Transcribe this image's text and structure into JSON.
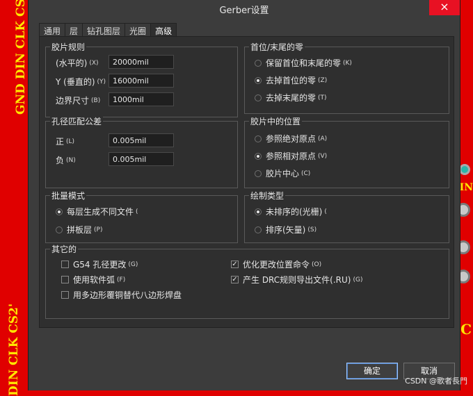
{
  "background": {
    "pcb_left_top": "GND DIN CLK CS1'",
    "pcb_left_bottom": "DIN CLK CS2'",
    "pcb_right_mid": "IN",
    "pcb_right_bottom": "C",
    "watermark": "CSDN @歌者長門"
  },
  "colors": {
    "pcb_bg": "#e00000",
    "silkscreen": "#ffe600",
    "dialog_bg": "#3c3c3c",
    "close_red": "#e81123"
  },
  "window": {
    "title": "Gerber设置",
    "close_icon": "×"
  },
  "tabs": [
    {
      "label": "通用"
    },
    {
      "label": "层"
    },
    {
      "label": "钻孔图层"
    },
    {
      "label": "光圈"
    },
    {
      "label": "高级"
    }
  ],
  "film_rules": {
    "title": "胶片规则",
    "x_label": "(水平的)",
    "x_shortcut": "(X)",
    "x_value": "20000mil",
    "y_label": "Y (垂直的)",
    "y_shortcut": "(Y)",
    "y_value": "16000mil",
    "border_label": "边界尺寸",
    "border_shortcut": "(B)",
    "border_value": "1000mil"
  },
  "leading_trailing": {
    "title": "首位/末尾的零",
    "options": [
      {
        "label": "保留首位和末尾的零",
        "shortcut": "(K)"
      },
      {
        "label": "去掉首位的零",
        "shortcut": "(Z)"
      },
      {
        "label": "去掉末尾的零",
        "shortcut": "(T)"
      }
    ]
  },
  "aperture_match": {
    "title": "孔径匹配公差",
    "plus_label": "正",
    "plus_shortcut": "(L)",
    "plus_value": "0.005mil",
    "minus_label": "负",
    "minus_shortcut": "(N)",
    "minus_value": "0.005mil"
  },
  "film_position": {
    "title": "胶片中的位置",
    "options": [
      {
        "label": "参照绝对原点",
        "shortcut": "(A)"
      },
      {
        "label": "参照相对原点",
        "shortcut": "(V)"
      },
      {
        "label": "胶片中心",
        "shortcut": "(C)"
      }
    ]
  },
  "batch_mode": {
    "title": "批量模式",
    "options": [
      {
        "label": "每层生成不同文件",
        "shortcut": "("
      },
      {
        "label": "拼板层",
        "shortcut": "(P)"
      }
    ]
  },
  "plot_type": {
    "title": "绘制类型",
    "options": [
      {
        "label": "未排序的(光栅)",
        "shortcut": "("
      },
      {
        "label": "排序(矢量)",
        "shortcut": "(S)"
      }
    ]
  },
  "other": {
    "title": "其它的",
    "left": [
      {
        "label": "G54 孔径更改",
        "shortcut": "(G)"
      },
      {
        "label": "使用软件弧",
        "shortcut": "(F)"
      },
      {
        "label": "用多边形覆铜替代八边形焊盘",
        "shortcut": ""
      }
    ],
    "right": [
      {
        "label": "优化更改位置命令",
        "shortcut": "(O)"
      },
      {
        "label": "产生 DRC规则导出文件(.RU)",
        "shortcut": "(G)"
      }
    ],
    "checkmark": "✓"
  },
  "buttons": {
    "ok": "确定",
    "cancel": "取消"
  }
}
